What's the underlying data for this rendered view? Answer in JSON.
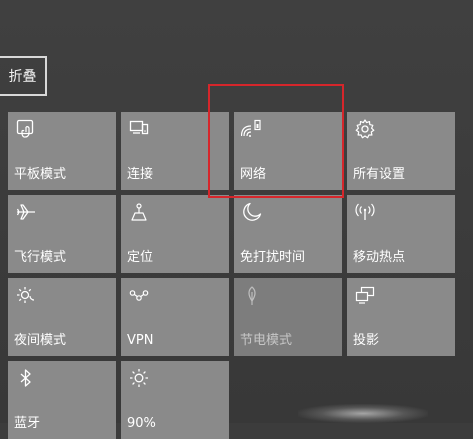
{
  "collapse_label": "折叠",
  "tiles": [
    {
      "label": "平板模式",
      "icon": "tablet-mode-icon",
      "enabled": true
    },
    {
      "label": "连接",
      "icon": "connect-icon",
      "enabled": true
    },
    {
      "label": "网络",
      "icon": "network-icon",
      "enabled": true
    },
    {
      "label": "所有设置",
      "icon": "gear-icon",
      "enabled": true
    },
    {
      "label": "飞行模式",
      "icon": "airplane-icon",
      "enabled": true
    },
    {
      "label": "定位",
      "icon": "location-icon",
      "enabled": true
    },
    {
      "label": "免打扰时间",
      "icon": "moon-icon",
      "enabled": true
    },
    {
      "label": "移动热点",
      "icon": "hotspot-icon",
      "enabled": true
    },
    {
      "label": "夜间模式",
      "icon": "night-light-icon",
      "enabled": true
    },
    {
      "label": "VPN",
      "icon": "vpn-icon",
      "enabled": true
    },
    {
      "label": "节电模式",
      "icon": "battery-saver-icon",
      "enabled": false
    },
    {
      "label": "投影",
      "icon": "project-icon",
      "enabled": true
    },
    {
      "label": "蓝牙",
      "icon": "bluetooth-icon",
      "enabled": true
    },
    {
      "label": "90%",
      "icon": "brightness-icon",
      "enabled": true
    }
  ],
  "colors": {
    "background": "#3c3c3c",
    "tile": "#8a8a8a",
    "highlight": "#d6262b"
  }
}
